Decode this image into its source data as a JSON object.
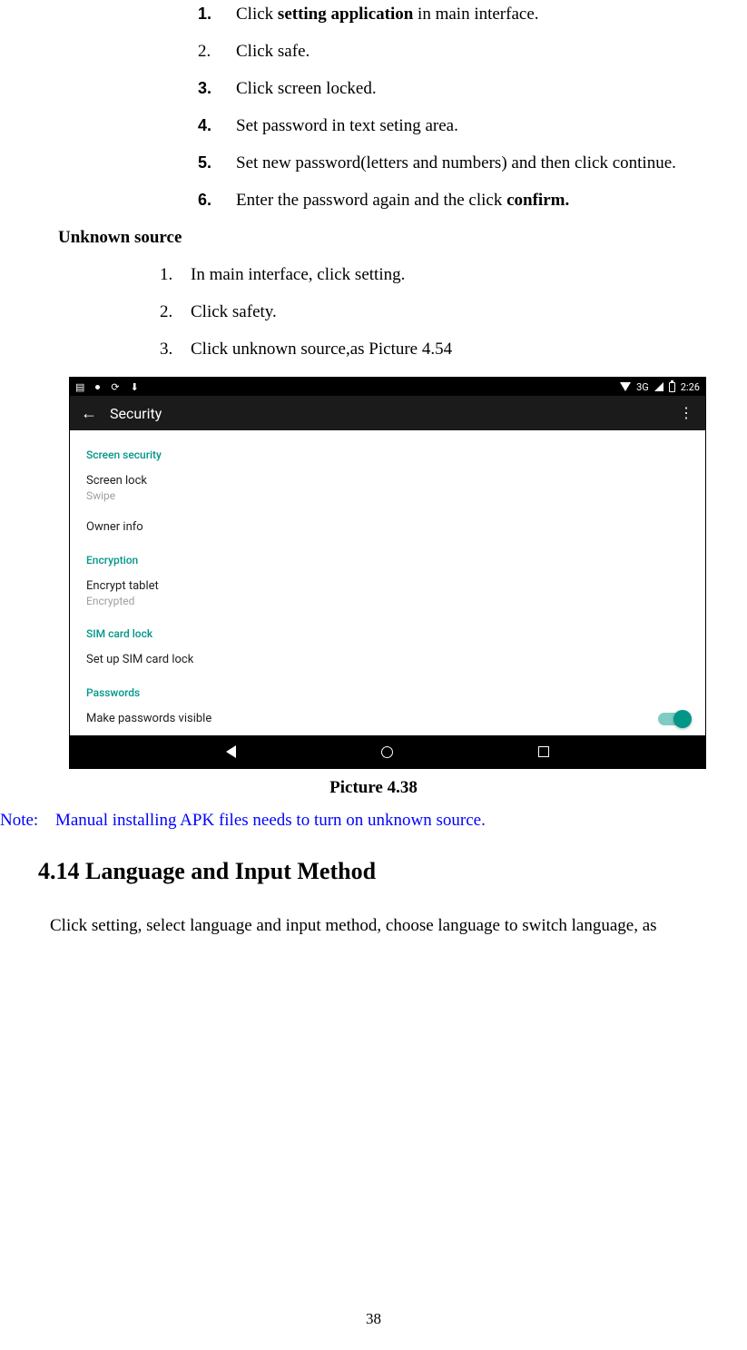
{
  "list1": {
    "items": [
      {
        "num": "1.",
        "bold_num": true,
        "pre": "Click ",
        "bold": "setting application",
        "post": " in main interface."
      },
      {
        "num": "2.",
        "bold_num": false,
        "pre": "Click safe.",
        "bold": "",
        "post": ""
      },
      {
        "num": "3.",
        "bold_num": true,
        "pre": "Click screen locked.",
        "bold": "",
        "post": ""
      },
      {
        "num": "4.",
        "bold_num": true,
        "pre": "Set password in text seting area.",
        "bold": "",
        "post": ""
      },
      {
        "num": "5.",
        "bold_num": true,
        "pre": "Set new password(letters and numbers) and then click continue.",
        "bold": "",
        "post": ""
      },
      {
        "num": "6.",
        "bold_num": true,
        "pre": "Enter the password again and the click ",
        "bold": "confirm.",
        "post": ""
      }
    ]
  },
  "subhead": "Unknown source",
  "list2": {
    "items": [
      {
        "num": "1.",
        "text": "In main interface, click setting."
      },
      {
        "num": "2.",
        "text": "Click safety."
      },
      {
        "num": "3.",
        "text": "Click unknown source,as Picture 4.54"
      }
    ]
  },
  "screenshot": {
    "status": {
      "network": "3G",
      "time": "2:26"
    },
    "appbar_title": "Security",
    "sections": [
      {
        "head": "Screen security",
        "items": [
          {
            "primary": "Screen lock",
            "secondary": "Swipe"
          },
          {
            "primary": "Owner info",
            "secondary": ""
          }
        ]
      },
      {
        "head": "Encryption",
        "items": [
          {
            "primary": "Encrypt tablet",
            "secondary": "Encrypted"
          }
        ]
      },
      {
        "head": "SIM card lock",
        "items": [
          {
            "primary": "Set up SIM card lock",
            "secondary": ""
          }
        ]
      },
      {
        "head": "Passwords",
        "items": [
          {
            "primary": "Make passwords visible",
            "secondary": "",
            "toggle": true
          }
        ]
      }
    ]
  },
  "caption": "Picture 4.38",
  "note": {
    "label": "Note:",
    "text": "Manual installing APK files needs to turn on unknown source."
  },
  "heading": "4.14  Language and Input Method",
  "body": "Click setting, select language and input method, choose language to switch language, as",
  "page_number": "38"
}
